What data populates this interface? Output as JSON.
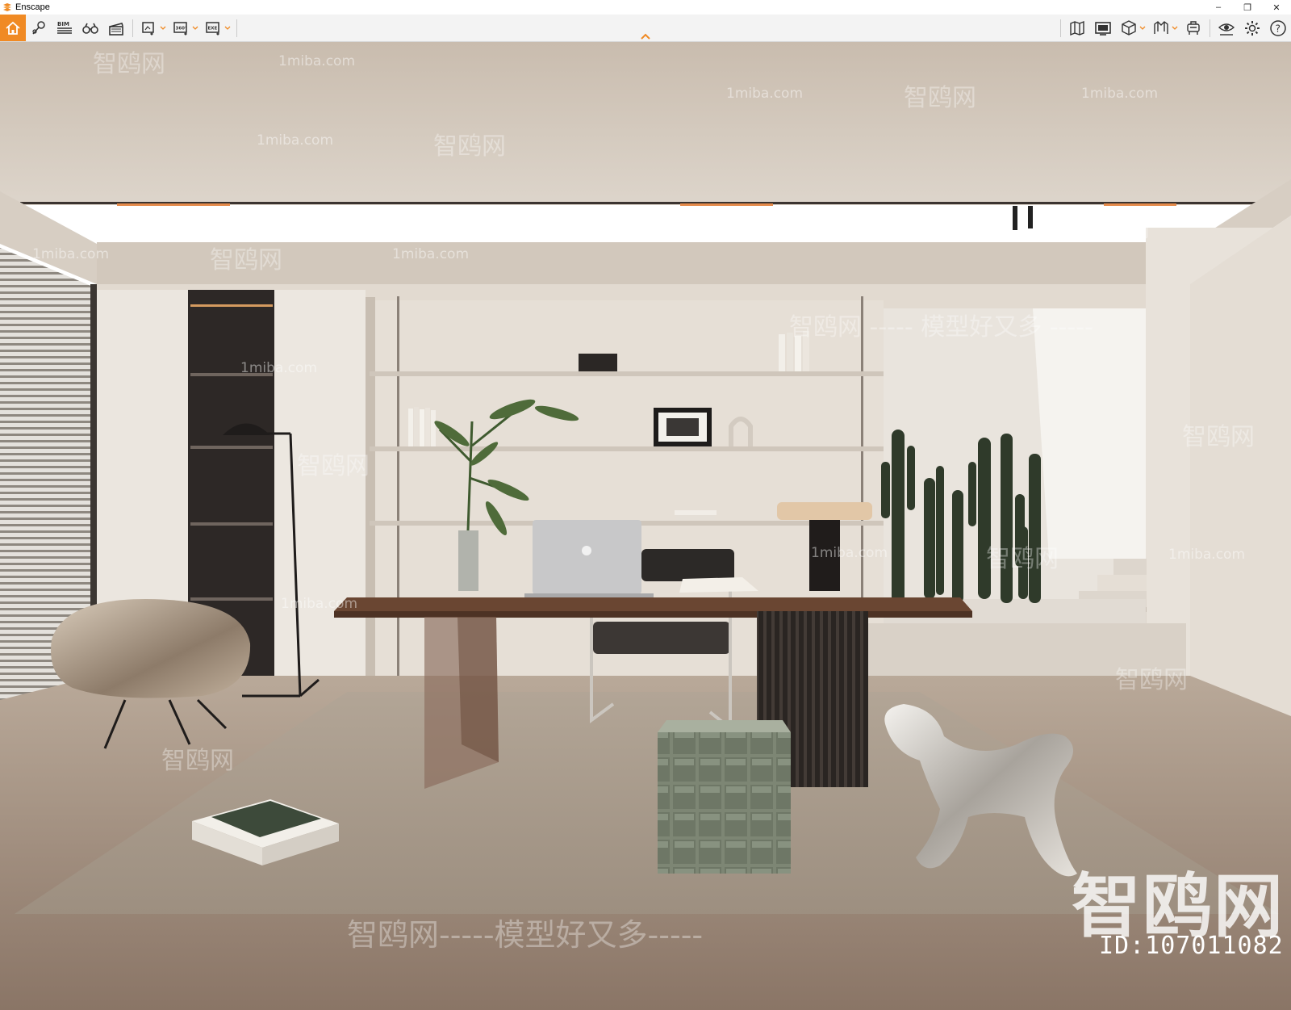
{
  "window": {
    "title": "Enscape",
    "controls": {
      "minimize": "–",
      "maximize": "❐",
      "close": "✕"
    }
  },
  "toolbar": {
    "left_tools": [
      {
        "name": "home-button",
        "icon": "home-icon"
      },
      {
        "name": "view-management-button",
        "icon": "pin-icon"
      },
      {
        "name": "bim-button",
        "icon": "bim-icon",
        "label": "BIM"
      },
      {
        "name": "explore-button",
        "icon": "binoculars-icon"
      },
      {
        "name": "video-editor-button",
        "icon": "clapper-icon"
      },
      {
        "name": "screenshot-button",
        "icon": "screenshot-icon"
      },
      {
        "name": "panorama-button",
        "icon": "panorama-icon",
        "label": "360°"
      },
      {
        "name": "export-exe-button",
        "icon": "export-icon",
        "label": "EXE"
      }
    ],
    "right_tools": [
      {
        "name": "map-button",
        "icon": "map-icon"
      },
      {
        "name": "display-button",
        "icon": "display-icon"
      },
      {
        "name": "cube-button",
        "icon": "cube-icon"
      },
      {
        "name": "book-button",
        "icon": "book-icon"
      },
      {
        "name": "asset-library-button",
        "icon": "assets-icon"
      },
      {
        "name": "visual-settings-button",
        "icon": "eye-settings-icon"
      },
      {
        "name": "settings-button",
        "icon": "gear-icon"
      },
      {
        "name": "help-button",
        "icon": "help-icon",
        "label": "?"
      }
    ]
  },
  "colors": {
    "accent": "#f08a24",
    "toolbar_bg": "#f3f3f3",
    "wall": "#e3dcd2",
    "ceiling": "#d8cfc4",
    "floor": "#8e7a6c",
    "rug": "#a89a8c",
    "desk": "#5e3e2c"
  },
  "watermarks": {
    "site_small": "1miba.com",
    "brand": "智鸥网",
    "dashes": "————",
    "slogan_line": "智鸥网 ----- 模型好又多 -----",
    "slogan_line_bottom": "智鸥网-----模型好又多-----",
    "big_brand": "智鸥网",
    "id_label": "ID:107011082"
  },
  "scene": {
    "type": "rendered interior: study with desk, shelves, cacti, lounge chair"
  }
}
